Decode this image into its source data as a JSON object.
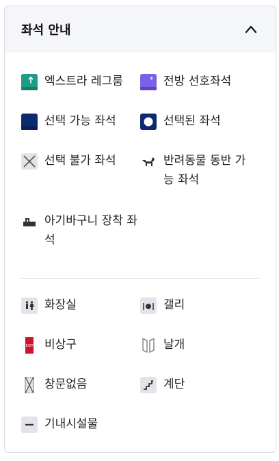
{
  "header": {
    "title": "좌석 안내"
  },
  "seats": [
    {
      "key": "extra-legroom",
      "label": "엑스트라 레그룸"
    },
    {
      "key": "front-preferred",
      "label": "전방 선호좌석"
    },
    {
      "key": "available",
      "label": "선택 가능 좌석"
    },
    {
      "key": "selected",
      "label": "선택된 좌석"
    },
    {
      "key": "unavailable",
      "label": "선택 불가 좌석"
    },
    {
      "key": "pet",
      "label": "반려동물 동반 가능 좌석"
    },
    {
      "key": "bassinet",
      "label": "아기바구니 장착 좌석"
    }
  ],
  "facilities": [
    {
      "key": "lavatory",
      "label": "화장실"
    },
    {
      "key": "galley",
      "label": "갤리"
    },
    {
      "key": "exit",
      "label": "비상구",
      "badge": "EXIT"
    },
    {
      "key": "wing",
      "label": "날개"
    },
    {
      "key": "no-window",
      "label": "창문없음"
    },
    {
      "key": "stairs",
      "label": "계단"
    },
    {
      "key": "onboard-facility",
      "label": "기내시설물"
    }
  ],
  "colors": {
    "extra_legroom": "#1a9e86",
    "front_preferred": "#7b61e8",
    "available": "#0e2a6e",
    "selected": "#0e2a6e",
    "unavailable_bg": "#e3e4ea",
    "facility_bg": "#e3e4ea",
    "exit_red": "#d0112b",
    "icon_dark": "#333333"
  }
}
